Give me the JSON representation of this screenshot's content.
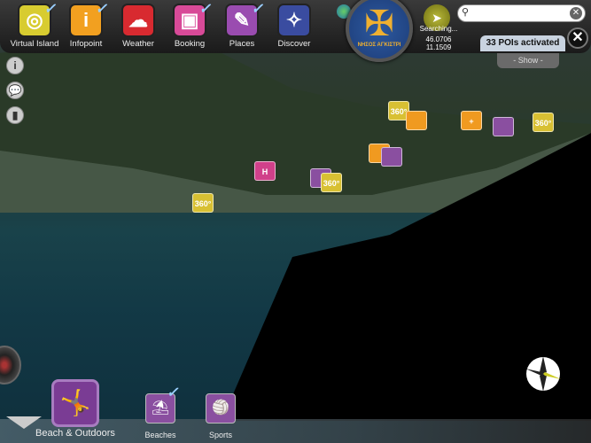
{
  "toolbar": {
    "items": [
      {
        "label": "Virtual Island",
        "color": "#d8cc30",
        "icon": "island-icon",
        "checked": true
      },
      {
        "label": "Infopoint",
        "color": "#f2a020",
        "icon": "info-icon",
        "checked": true
      },
      {
        "label": "Weather",
        "color": "#d82a30",
        "icon": "cloud-icon",
        "checked": false
      },
      {
        "label": "Booking",
        "color": "#d84a98",
        "icon": "suitcase-icon",
        "checked": true
      },
      {
        "label": "Places",
        "color": "#9a4cb0",
        "icon": "pushpin-icon",
        "checked": true
      },
      {
        "label": "Discover",
        "color": "#3a4ca0",
        "icon": "compass-icon",
        "checked": false
      }
    ]
  },
  "emblem": {
    "text": "ΝΗΣΟΣ ΑΓΚΙΣΤΡΙ"
  },
  "search": {
    "status": "Searching...",
    "lat": "46.0706",
    "lon": "11.1509",
    "value": "",
    "placeholder": ""
  },
  "pois": {
    "activated": "33 POIs activated",
    "show": "- Show -"
  },
  "markers": [
    {
      "label": "360°",
      "type": "panorama"
    },
    {
      "label": "360°",
      "type": "panorama"
    },
    {
      "label": "360°",
      "type": "panorama"
    },
    {
      "label": "360°",
      "type": "panorama"
    },
    {
      "label": "H",
      "type": "hotel"
    },
    {
      "label": "+",
      "type": "pharmacy"
    }
  ],
  "category": {
    "label": "Beach & Outdoors",
    "sub": [
      {
        "label": "Beaches",
        "checked": true
      },
      {
        "label": "Sports",
        "checked": false
      }
    ]
  }
}
